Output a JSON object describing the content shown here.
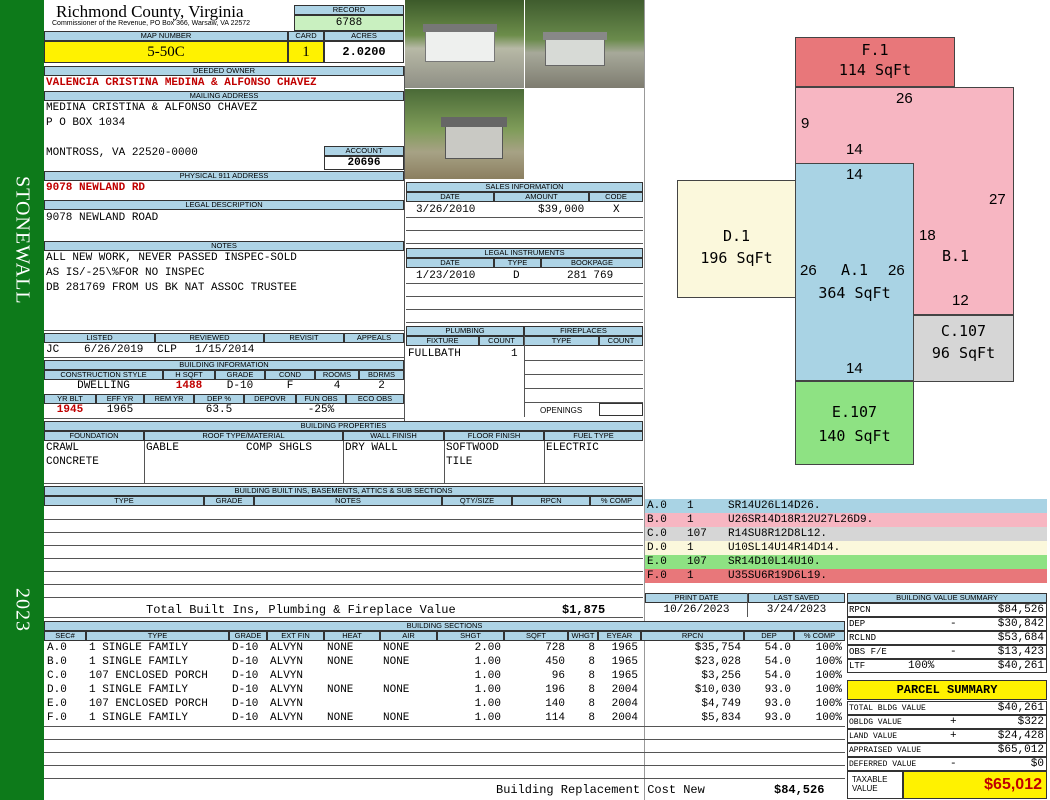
{
  "sidebar": {
    "district": "STONEWALL",
    "year": "2023",
    "color": "#0d7a1a"
  },
  "header": {
    "county": "Richmond County, Virginia",
    "commissioner": "Commissioner of the Revenue, PO Box 366, Warsaw, VA 22572",
    "record_label": "RECORD",
    "record": "6788",
    "map_label": "MAP NUMBER",
    "map_number": "5-50C",
    "card_label": "CARD",
    "card": "1",
    "acres_label": "ACRES",
    "acres": "2.0200"
  },
  "owner": {
    "deeded_label": "DEEDED OWNER",
    "deeded": "VALENCIA CRISTINA MEDINA & ALFONSO CHAVEZ",
    "mailing_label": "MAILING ADDRESS",
    "mailing": [
      "MEDINA CRISTINA & ALFONSO CHAVEZ",
      "P O BOX 1034",
      "",
      "MONTROSS, VA 22520-0000"
    ],
    "account_label": "ACCOUNT",
    "account": "20696",
    "physical_label": "PHYSICAL 911 ADDRESS",
    "physical": "9078 NEWLAND RD"
  },
  "legal": {
    "label": "LEGAL DESCRIPTION",
    "text": "9078 NEWLAND ROAD"
  },
  "notes": {
    "label": "NOTES",
    "lines": [
      "ALL NEW WORK, NEVER PASSED INSPEC-SOLD",
      "AS IS/-25\\%FOR NO INSPEC",
      "DB 281769 FROM US BK NAT ASSOC TRUSTEE"
    ]
  },
  "sales": {
    "label": "SALES INFORMATION",
    "headers": {
      "date": "DATE",
      "amount": "AMOUNT",
      "code": "CODE"
    },
    "rows": [
      {
        "date": "3/26/2010",
        "amount": "$39,000",
        "code": "X"
      }
    ]
  },
  "instruments": {
    "label": "LEGAL INSTRUMENTS",
    "headers": {
      "date": "DATE",
      "type": "TYPE",
      "book": "BOOKPAGE"
    },
    "rows": [
      {
        "date": "1/23/2010",
        "type": "D",
        "book": "281 769"
      }
    ]
  },
  "review": {
    "listed_label": "LISTED",
    "reviewed_label": "REVIEWED",
    "revisit_label": "REVISIT",
    "appeals_label": "APPEALS",
    "listed_by": "JC",
    "listed_date": "6/26/2019",
    "reviewed_by": "CLP",
    "reviewed_date": "1/15/2014"
  },
  "building_info": {
    "label": "BUILDING INFORMATION",
    "h_style": "CONSTRUCTION STYLE",
    "h_sqft": "H SQFT",
    "h_grade": "GRADE",
    "h_cond": "COND",
    "h_rooms": "ROOMS",
    "h_bdrms": "BDRMS",
    "style": "DWELLING",
    "sqft": "1488",
    "grade": "D-10",
    "cond": "F",
    "rooms": "4",
    "bdrms": "2",
    "h_yrblt": "YR BLT",
    "h_effyr": "EFF YR",
    "h_remyr": "REM YR",
    "h_dep": "DEP %",
    "h_depovr": "DEPOVR",
    "h_funobs": "FUN OBS",
    "h_ecoobs": "ECO OBS",
    "yrblt": "1945",
    "effyr": "1965",
    "dep": "63.5",
    "funobs": "-25%"
  },
  "plumbing": {
    "label": "PLUMBING",
    "h_fixture": "FIXTURE",
    "h_count": "COUNT",
    "fixture": "FULLBATH",
    "count": "1"
  },
  "fireplaces": {
    "label": "FIREPLACES",
    "h_type": "TYPE",
    "h_count": "COUNT",
    "openings_label": "OPENINGS"
  },
  "properties": {
    "label": "BUILDING PROPERTIES",
    "h_foundation": "FOUNDATION",
    "h_roof": "ROOF TYPE/MATERIAL",
    "h_wall": "WALL FINISH",
    "h_floor": "FLOOR FINISH",
    "h_fuel": "FUEL TYPE",
    "foundation": [
      "CRAWL",
      "CONCRETE"
    ],
    "roof_type": "GABLE",
    "roof_mat": "COMP SHGLS",
    "wall": "DRY WALL",
    "floor": [
      "SOFTWOOD",
      "TILE"
    ],
    "fuel": "ELECTRIC"
  },
  "builtins": {
    "label": "BUILDING BUILT INS, BASEMENTS, ATTICS & SUB SECTIONS",
    "headers": [
      "TYPE",
      "GRADE",
      "NOTES",
      "QTY/SIZE",
      "RPCN",
      "% COMP"
    ],
    "total_label": "Total Built Ins, Plumbing & Fireplace Value",
    "total": "$1,875"
  },
  "sketch": {
    "sections": [
      {
        "id": "F.1",
        "area": "114 SqFt",
        "color": "#e8777a"
      },
      {
        "id": "B.1",
        "area": "",
        "color": "#f7b6c2"
      },
      {
        "id": "D.1",
        "area": "196 SqFt",
        "color": "#fbf8dc"
      },
      {
        "id": "A.1",
        "area": "364 SqFt",
        "color": "#a9d3e4"
      },
      {
        "id": "C.107",
        "area": "96 SqFt",
        "color": "#d6d6d6"
      },
      {
        "id": "E.107",
        "area": "140 SqFt",
        "color": "#8ee283"
      }
    ],
    "dims": [
      "26",
      "9",
      "14",
      "14",
      "27",
      "18",
      "26",
      "26",
      "12",
      "14"
    ]
  },
  "vectors": [
    {
      "sec": "A.0",
      "n": "1",
      "code": "SR14U26L14D26.",
      "color": "#a9d3e4"
    },
    {
      "sec": "B.0",
      "n": "1",
      "code": "U26SR14D18R12U27L26D9.",
      "color": "#f7b6c2"
    },
    {
      "sec": "C.0",
      "n": "107",
      "code": "R14SU8R12D8L12.",
      "color": "#d6d6d6"
    },
    {
      "sec": "D.0",
      "n": "1",
      "code": "U10SL14U14R14D14.",
      "color": "#fbf8dc"
    },
    {
      "sec": "E.0",
      "n": "107",
      "code": "SR14D10L14U10.",
      "color": "#8ee283"
    },
    {
      "sec": "F.0",
      "n": "1",
      "code": "U35SU6R19D6L19.",
      "color": "#e8777a"
    }
  ],
  "print": {
    "print_label": "PRINT DATE",
    "print_date": "10/26/2023",
    "saved_label": "LAST SAVED",
    "saved_date": "3/24/2023"
  },
  "sections_table": {
    "label": "BUILDING SECTIONS",
    "headers": [
      "SEC#",
      "TYPE",
      "GRADE",
      "EXT FIN",
      "HEAT",
      "AIR",
      "SHGT",
      "SQFT",
      "WHGT",
      "EYEAR",
      "RPCN",
      "DEP",
      "% COMP"
    ],
    "rows": [
      [
        "A.0",
        "1 SINGLE FAMILY",
        "D-10",
        "ALVYN",
        "NONE",
        "NONE",
        "2.00",
        "728",
        "8",
        "1965",
        "$35,754",
        "54.0",
        "100%"
      ],
      [
        "B.0",
        "1 SINGLE FAMILY",
        "D-10",
        "ALVYN",
        "NONE",
        "NONE",
        "1.00",
        "450",
        "8",
        "1965",
        "$23,028",
        "54.0",
        "100%"
      ],
      [
        "C.0",
        "107 ENCLOSED PORCH",
        "D-10",
        "ALVYN",
        "",
        "",
        "1.00",
        "96",
        "8",
        "1965",
        "$3,256",
        "54.0",
        "100%"
      ],
      [
        "D.0",
        "1 SINGLE FAMILY",
        "D-10",
        "ALVYN",
        "NONE",
        "NONE",
        "1.00",
        "196",
        "8",
        "2004",
        "$10,030",
        "93.0",
        "100%"
      ],
      [
        "E.0",
        "107 ENCLOSED PORCH",
        "D-10",
        "ALVYN",
        "",
        "",
        "1.00",
        "140",
        "8",
        "2004",
        "$4,749",
        "93.0",
        "100%"
      ],
      [
        "F.0",
        "1 SINGLE FAMILY",
        "D-10",
        "ALVYN",
        "NONE",
        "NONE",
        "1.00",
        "114",
        "8",
        "2004",
        "$5,834",
        "93.0",
        "100%"
      ]
    ],
    "replacement_label": "Building Replacement Cost New",
    "replacement": "$84,526"
  },
  "value_summary": {
    "label": "BUILDING VALUE SUMMARY",
    "rows": [
      {
        "k": "RPCN",
        "s": "",
        "v": "$84,526"
      },
      {
        "k": "DEP",
        "s": "-",
        "v": "$30,842"
      },
      {
        "k": "RCLND",
        "s": "",
        "v": "$53,684"
      },
      {
        "k": "OBS F/E",
        "s": "-",
        "v": "$13,423"
      },
      {
        "k": "LTF",
        "s": "100%",
        "v": "$40,261"
      }
    ]
  },
  "parcel": {
    "label": "PARCEL SUMMARY",
    "rows": [
      {
        "k": "TOTAL BLDG VALUE",
        "s": "",
        "v": "$40,261"
      },
      {
        "k": "OBLDG VALUE",
        "s": "+",
        "v": "$322"
      },
      {
        "k": "LAND VALUE",
        "s": "+",
        "v": "$24,428"
      },
      {
        "k": "APPRAISED VALUE",
        "s": "",
        "v": "$65,012"
      },
      {
        "k": "DEFERRED VALUE",
        "s": "-",
        "v": "$0"
      }
    ],
    "taxable_label": "TAXABLE VALUE",
    "taxable": "$65,012"
  }
}
